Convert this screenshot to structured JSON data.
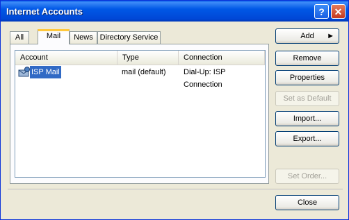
{
  "window": {
    "title": "Internet Accounts",
    "help_label": "?",
    "close_label": "✕"
  },
  "tabs": [
    {
      "label": "All"
    },
    {
      "label": "Mail"
    },
    {
      "label": "News"
    },
    {
      "label": "Directory Service"
    }
  ],
  "list": {
    "columns": [
      "Account",
      "Type",
      "Connection"
    ],
    "rows": [
      {
        "account": "ISP Mail",
        "type": "mail (default)",
        "connection": "Dial-Up: ISP Connection",
        "icon": "mail-account-icon"
      }
    ]
  },
  "buttons": {
    "add": "Add",
    "remove": "Remove",
    "properties": "Properties",
    "set_default": "Set as Default",
    "import": "Import...",
    "export": "Export...",
    "set_order": "Set Order...",
    "close": "Close"
  },
  "colors": {
    "titlebar": "#0058e6",
    "selection": "#316ac5",
    "tab_highlight": "#ffc83c"
  }
}
